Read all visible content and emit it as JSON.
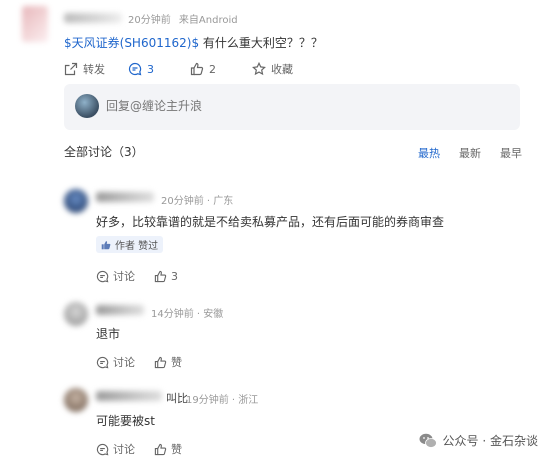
{
  "post": {
    "meta_time": "20分钟前",
    "meta_source": "来自Android",
    "stock_link": "$天风证券(SH601162)$",
    "content": " 有什么重大利空？？？",
    "actions": {
      "repost": "转发",
      "comment_count": "3",
      "like_count": "2",
      "favorite": "收藏"
    }
  },
  "reply_box": {
    "placeholder": "回复@缠论主升浪"
  },
  "comments_header": {
    "title": "全部讨论（3）",
    "sort": [
      "最热",
      "最新",
      "最早"
    ]
  },
  "comments": [
    {
      "time": "20分钟前",
      "location": "广东",
      "text": "好多，比较靠谱的就是不给卖私募产品，还有后面可能的券商审查",
      "badge": "作者 赞过",
      "discuss": "讨论",
      "like": "3"
    },
    {
      "time": "14分钟前",
      "location": "安徽",
      "text": "退市",
      "discuss": "讨论",
      "like": "赞"
    },
    {
      "name_tail": "叫比",
      "time": "19分钟前",
      "location": "浙江",
      "text": "可能要被st",
      "discuss": "讨论",
      "like": "赞"
    }
  ],
  "watermark": "公众号 · 金石杂谈"
}
